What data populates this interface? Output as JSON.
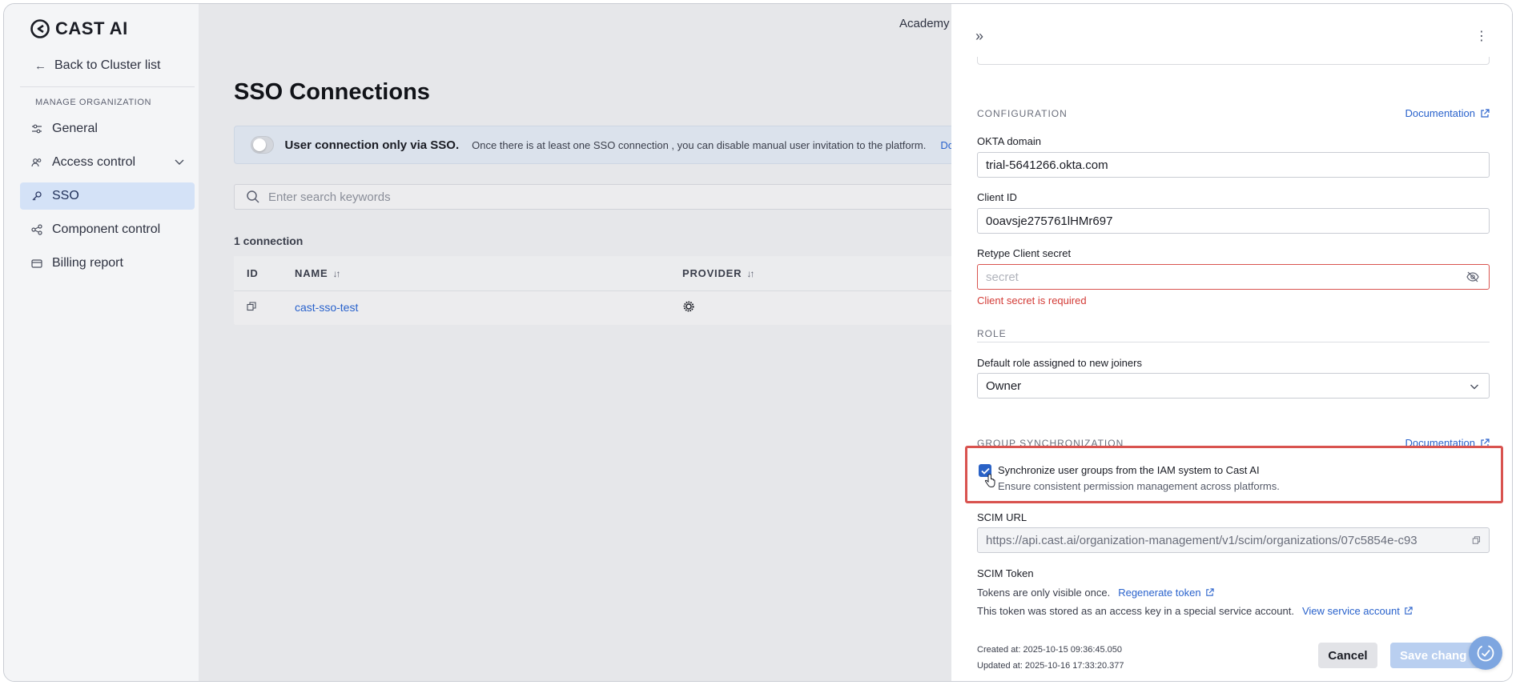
{
  "brand": {
    "name": "CAST AI"
  },
  "sidebar": {
    "back_label": "Back to Cluster list",
    "section_label": "MANAGE ORGANIZATION",
    "items": [
      {
        "label": "General",
        "icon": "sliders-icon"
      },
      {
        "label": "Access control",
        "icon": "users-icon"
      },
      {
        "label": "SSO",
        "icon": "key-icon"
      },
      {
        "label": "Component control",
        "icon": "components-icon"
      },
      {
        "label": "Billing report",
        "icon": "billing-icon"
      }
    ]
  },
  "main": {
    "top_link": "Academy",
    "title": "SSO Connections",
    "banner": {
      "strong": "User connection only via SSO.",
      "text": "Once there is at least one SSO connection , you can disable manual user invitation to the platform.",
      "link": "Do"
    },
    "search_placeholder": "Enter search keywords",
    "count": "1 connection",
    "table": {
      "headers": {
        "id": "ID",
        "name": "NAME",
        "provider": "PROVIDER"
      },
      "rows": [
        {
          "name": "cast-sso-test",
          "provider_icon": "okta-icon"
        }
      ]
    }
  },
  "drawer": {
    "configuration_label": "CONFIGURATION",
    "documentation": "Documentation",
    "okta_domain_label": "OKTA domain",
    "okta_domain_value": "trial-5641266.okta.com",
    "client_id_label": "Client ID",
    "client_id_value": "0oavsje275761lHMr697",
    "secret_label": "Retype Client secret",
    "secret_placeholder": "secret",
    "secret_error": "Client secret is required",
    "role_label": "ROLE",
    "default_role_label": "Default role assigned to new joiners",
    "default_role_value": "Owner",
    "group_sync_label": "GROUP SYNCHRONIZATION",
    "sync_checkbox_title": "Synchronize user groups from the IAM system to Cast AI",
    "sync_checkbox_sub": "Ensure consistent permission management across platforms.",
    "scim_url_label": "SCIM URL",
    "scim_url_value": "https://api.cast.ai/organization-management/v1/scim/organizations/07c5854e-c93",
    "scim_token_label": "SCIM Token",
    "token_visibility_text": "Tokens are only visible once.",
    "regenerate_link": "Regenerate token",
    "token_stored_text": "This token was stored as an access key in a special service account.",
    "service_account_link": "View service account",
    "created_at": "Created at: 2025-10-15 09:36:45.050",
    "updated_at": "Updated at: 2025-10-16 17:33:20.377",
    "cancel": "Cancel",
    "save": "Save chang"
  },
  "colors": {
    "accent": "#2962cc",
    "error": "#d33b36",
    "active_nav": "#d4e2f7"
  }
}
